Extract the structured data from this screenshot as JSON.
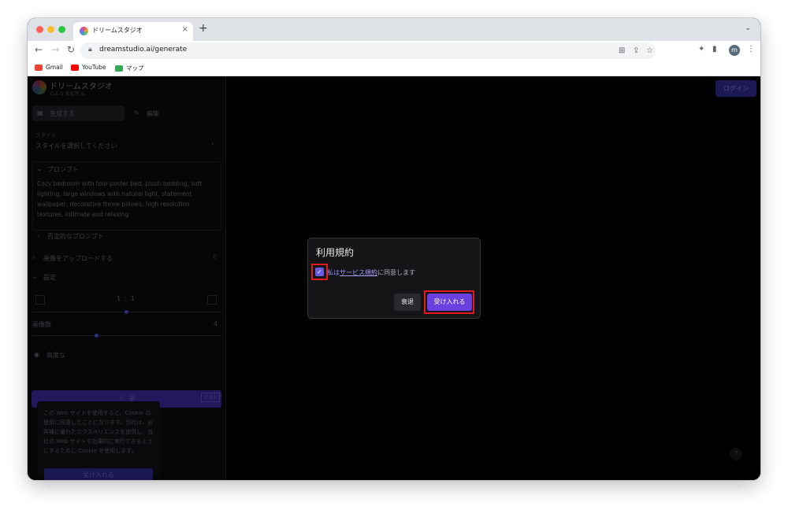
{
  "browser": {
    "tab_title": "ドリームスタジオ",
    "tab_close": "×",
    "new_tab": "+",
    "url": "dreamstudio.ai/generate",
    "profile_initial": "m",
    "bookmarks": [
      {
        "label": "Gmail",
        "icon": "gmail-icon",
        "color": "#ea4335"
      },
      {
        "label": "YouTube",
        "icon": "youtube-icon",
        "color": "#ff0000"
      },
      {
        "label": "マップ",
        "icon": "maps-icon",
        "color": "#34a853"
      }
    ],
    "window_dots": [
      "#ff5f57",
      "#febc2e",
      "#28c840"
    ]
  },
  "app": {
    "brand": "ドリームスタジオ",
    "brand_sub": "による 安定性.ai",
    "login": "ログイン",
    "tabs": {
      "generate": "生成する",
      "edit": "編集"
    },
    "style": {
      "label": "スタイル",
      "value": "スタイルを選択してください"
    },
    "prompt": {
      "heading": "プロンプト",
      "text": "Cozy bedroom with four-poster bed, plush bedding, soft lighting, large windows with natural light, statement wallpaper, decorative throw pillows, high resolution textures, intimate and relaxing"
    },
    "negative_prompt": "否定的なプロンプト",
    "upload": "画像をアップロードする",
    "settings": {
      "heading": "設定",
      "ratio_left": "1",
      "ratio_sep": ":",
      "ratio_right": "1",
      "image_count_label": "画像数",
      "image_count_value": "4",
      "advanced": "高度な"
    },
    "generate_button": {
      "label": "夢",
      "credits": "0.91"
    },
    "cookie": {
      "text": "この Web サイトを使用すると、Cookie の使用に同意したことになります。当社は、お客様に優れたエクスペリエンスを提供し、当社の Web サイトを効果的に実行できるようにするために Cookie を使用します。",
      "accept": "受け入れる"
    },
    "help": "?"
  },
  "modal": {
    "title": "利用規約",
    "checkbox_checked": true,
    "agree_pre": "私は",
    "agree_link": "サービス規約",
    "agree_post": "に同意します",
    "decline": "衰退",
    "accept": "受け入れる"
  }
}
